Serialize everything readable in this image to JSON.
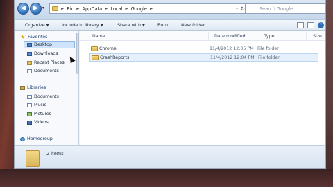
{
  "window": {
    "address": {
      "crumbs": [
        "Ric",
        "AppData",
        "Local",
        "Google"
      ],
      "dropdown_glyph": "▾",
      "refresh_glyph": "↻"
    },
    "nav": {
      "back_glyph": "◀",
      "forward_glyph": "▶",
      "recent_glyph": "▾"
    },
    "search": {
      "placeholder": "Search Google"
    }
  },
  "toolbar": {
    "organize_label": "Organize",
    "include_label": "Include in library",
    "share_label": "Share with",
    "burn_label": "Burn",
    "new_folder_label": "New folder",
    "help_glyph": "?"
  },
  "navpane": {
    "favorites": {
      "header": "Favorites",
      "items": [
        "Desktop",
        "Downloads",
        "Recent Places",
        "Documents"
      ],
      "selected": "Desktop"
    },
    "libraries": {
      "header": "Libraries",
      "items": [
        "Documents",
        "Music",
        "Pictures",
        "Videos"
      ]
    },
    "homegroup": {
      "header": "Homegroup"
    }
  },
  "columns": {
    "name": "Name",
    "date": "Date modified",
    "type": "Type",
    "size": "Size"
  },
  "files": [
    {
      "name": "Chrome",
      "date": "11/4/2012 12:05 PM",
      "type": "File folder"
    },
    {
      "name": "CrashReports",
      "date": "11/4/2012 12:04 PM",
      "type": "File folder"
    }
  ],
  "status": {
    "items_text": "2 items"
  },
  "colors": {
    "accent": "#2f6fb8",
    "folder": "#e8c862",
    "selection": "#cfe3fa"
  }
}
